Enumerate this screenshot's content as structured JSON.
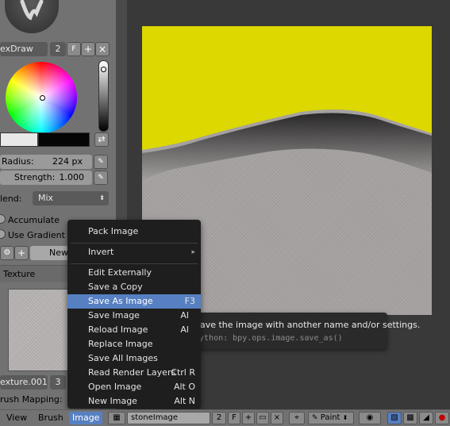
{
  "left_panel": {
    "brush_name": "exDraw",
    "brush_users": "2",
    "fake_user": "F",
    "radius_label": "Radius:",
    "radius_value": "224 px",
    "strength_label": "Strength:",
    "strength_value": "1.000",
    "blend_label": "lend:",
    "blend_value": "Mix",
    "accumulate_label": "Accumulate",
    "use_gradient_label": "Use Gradient",
    "new_button_partial": "New",
    "texture_section_label": "Texture",
    "texture_name": "exture.001",
    "texture_users": "3",
    "brush_mapping_label": "rush Mapping:"
  },
  "menu": {
    "items": [
      {
        "label": "Pack Image",
        "shortcut": ""
      },
      {
        "label": "Invert",
        "shortcut": "",
        "submenu": true
      },
      {
        "label": "Edit Externally",
        "shortcut": ""
      },
      {
        "label": "Save a Copy",
        "shortcut": ""
      },
      {
        "label": "Save As Image",
        "shortcut": "F3",
        "highlighted": true
      },
      {
        "label": "Save Image",
        "shortcut": "Al"
      },
      {
        "label": "Reload Image",
        "shortcut": "Al"
      },
      {
        "label": "Replace Image",
        "shortcut": ""
      },
      {
        "label": "Save All Images",
        "shortcut": ""
      },
      {
        "label": "Read Render Layers",
        "shortcut": "Ctrl R"
      },
      {
        "label": "Open Image",
        "shortcut": "Alt O"
      },
      {
        "label": "New Image",
        "shortcut": "Alt N"
      }
    ]
  },
  "tooltip": {
    "description": "Save the image with another name and/or settings.",
    "python": "Python: bpy.ops.image.save_as()"
  },
  "statusbar": {
    "view_label": "View",
    "brush_label": "Brush",
    "image_label": "Image",
    "image_name": "stoneImage",
    "image_users": "2",
    "fake_user": "F",
    "mode_label": "Paint"
  },
  "colors": {
    "accent": "#5680c2",
    "paint_yellow": "#dcd800",
    "panel_bg": "#727272",
    "menu_bg": "#1e1e1e"
  }
}
